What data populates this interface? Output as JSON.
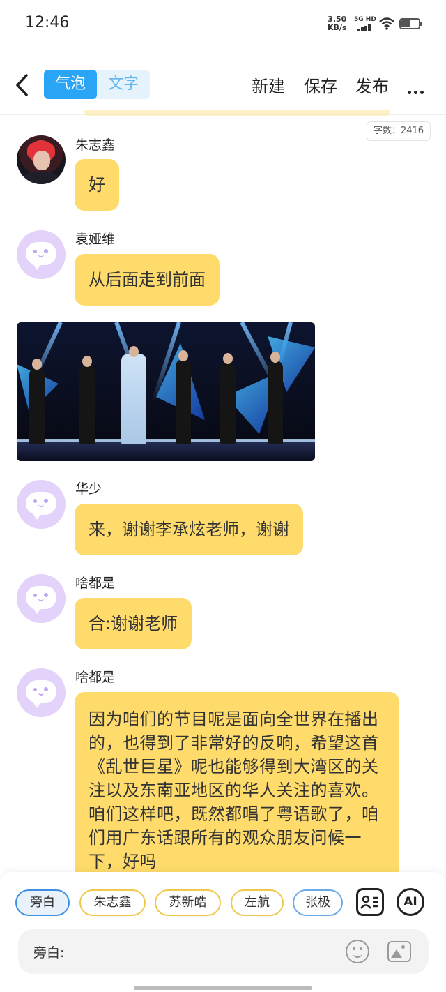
{
  "status": {
    "time": "12:46",
    "speed": "3.50",
    "speed_unit": "KB/s",
    "network": "5G HD"
  },
  "toolbar": {
    "mode_bubble": "气泡",
    "mode_text": "文字",
    "new": "新建",
    "save": "保存",
    "publish": "发布"
  },
  "word_count": "字数：2416",
  "messages": [
    {
      "name": "朱志鑫",
      "text": "好"
    },
    {
      "name": "袁娅维",
      "text": "从后面走到前面"
    },
    {
      "name": "华少",
      "text": "来，谢谢李承炫老师，谢谢"
    },
    {
      "name": "啥都是",
      "text": "合:谢谢老师"
    },
    {
      "name": "啥都是",
      "text": "因为咱们的节目呢是面向全世界在播出的，也得到了非常好的反响，希望这首《乱世巨星》呢也能够得到大湾区的关注以及东南亚地区的华人关注的喜欢。咱们这样吧，既然都唱了粤语歌了，咱们用广东话跟所有的观众朋友问候一下，好吗"
    }
  ],
  "roles": [
    "旁白",
    "朱志鑫",
    "苏新皓",
    "左航",
    "张极"
  ],
  "ai_label": "AI",
  "input": {
    "prefix": "旁白:"
  }
}
